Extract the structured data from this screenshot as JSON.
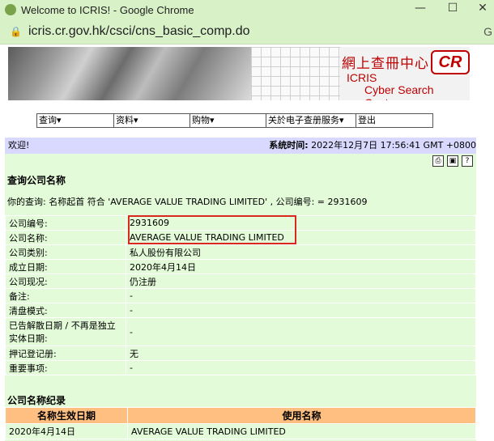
{
  "browser": {
    "window_title": "Welcome to ICRIS! - Google Chrome",
    "url": "icris.cr.gov.hk/csci/cns_basic_comp.do",
    "right_cut": "G",
    "min": "—",
    "max": "☐",
    "close": "✕"
  },
  "banner": {
    "title_zh": "網上查冊中心",
    "logo": "CR",
    "line1": "ICRIS",
    "line2": "Cyber Search Centre"
  },
  "menu": [
    "查询▾",
    "资料▾",
    "购物▾",
    "关於电子查册服务▾",
    "登出"
  ],
  "welcome": {
    "greeting": "欢迎!",
    "time_label": "系统时间:",
    "time_value": "2022年12月7日 17:56:41 GMT +0800"
  },
  "search": {
    "heading": "查询公司名称",
    "query": "你的查询: 名称起首 符合 'AVERAGE VALUE TRADING LIMITED' , 公司编号: = 2931609"
  },
  "company_info": [
    {
      "label": "公司编号:",
      "value": "2931609"
    },
    {
      "label": "公司名称:",
      "value": "AVERAGE VALUE TRADING LIMITED"
    },
    {
      "label": "公司类别:",
      "value": "私人股份有限公司"
    },
    {
      "label": "成立日期:",
      "value": "2020年4月14日"
    },
    {
      "label": "公司现况:",
      "value": "仍注册"
    },
    {
      "label": "备注:",
      "value": "-"
    },
    {
      "label": "清盘模式:",
      "value": "-"
    },
    {
      "label": "已告解散日期 / 不再是独立实体日期:",
      "value": "-"
    },
    {
      "label": "押记登记册:",
      "value": "无"
    },
    {
      "label": "重要事项:",
      "value": "-"
    }
  ],
  "history": {
    "heading": "公司名称纪录",
    "col1": "名称生效日期",
    "col2": "使用名称",
    "rows": [
      {
        "date": "2020年4月14日",
        "name": "AVERAGE VALUE TRADING LIMITED"
      }
    ]
  }
}
